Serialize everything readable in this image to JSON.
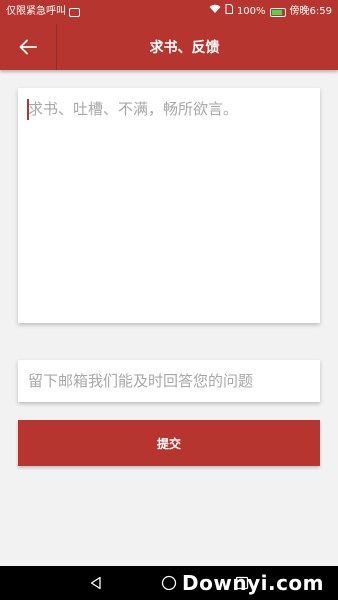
{
  "status_bar": {
    "left_text": "仅限紧急呼叫",
    "battery": "100%",
    "time": "傍晚6:59",
    "icons": [
      "sms-icon",
      "wifi-icon",
      "sim-icon",
      "battery-icon"
    ]
  },
  "app_bar": {
    "back_icon": "arrow-left-icon",
    "title": "求书、反馈"
  },
  "feedback": {
    "placeholder": "求书、吐槽、不满，畅所欲言。",
    "value": ""
  },
  "email": {
    "placeholder": "留下邮箱我们能及时回答您的问题",
    "value": ""
  },
  "submit": {
    "label": "提交"
  },
  "nav_bar": {
    "icons": [
      "back-triangle-icon",
      "home-circle-icon",
      "recents-square-icon"
    ]
  },
  "watermark": {
    "text": "Downyi.com"
  },
  "colors": {
    "accent": "#b6362f",
    "background": "#f2f2f2",
    "placeholder": "#a8a8a8"
  }
}
